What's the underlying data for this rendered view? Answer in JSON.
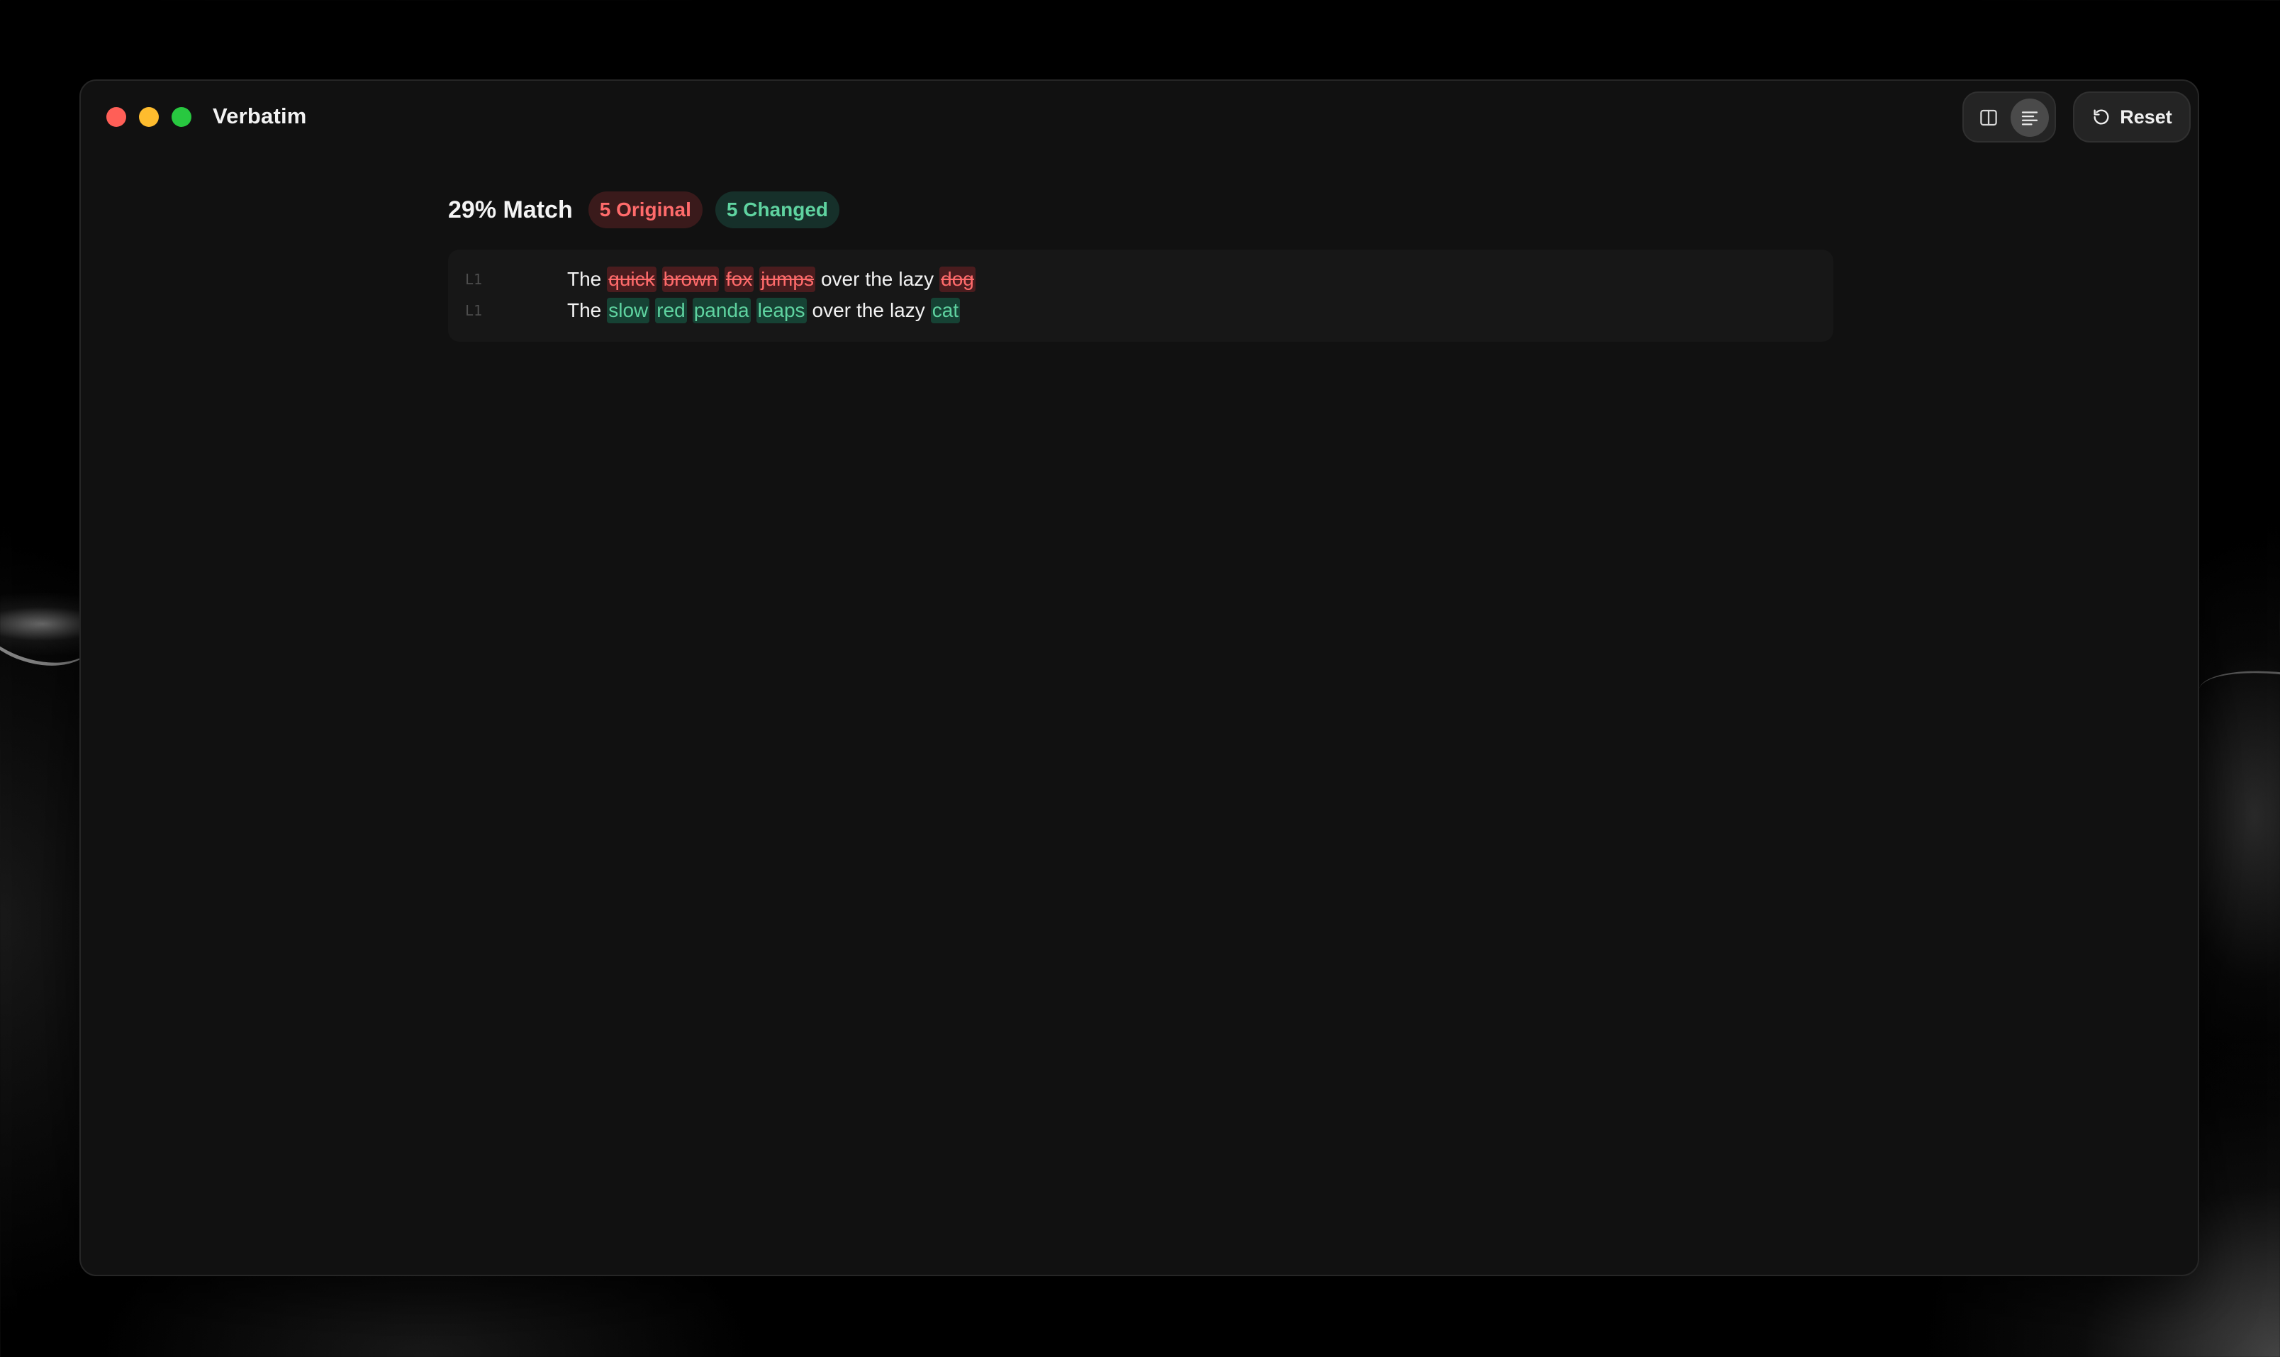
{
  "app": {
    "title": "Verbatim",
    "window_controls": [
      "close",
      "minimize",
      "zoom"
    ]
  },
  "toolbar": {
    "view_modes": [
      {
        "name": "split",
        "icon": "split-view-icon",
        "selected": false
      },
      {
        "name": "unified",
        "icon": "unified-view-icon",
        "selected": true
      }
    ],
    "reset_label": "Reset",
    "reset_icon": "reset-icon"
  },
  "summary": {
    "match": "29% Match",
    "original_badge": "5 Original",
    "changed_badge": "5 Changed"
  },
  "diff": {
    "lines": [
      {
        "line_label": "L1",
        "kind": "original",
        "tokens": [
          {
            "text": "The",
            "type": "same"
          },
          {
            "text": "quick",
            "type": "removed"
          },
          {
            "text": "brown",
            "type": "removed"
          },
          {
            "text": "fox",
            "type": "removed"
          },
          {
            "text": "jumps",
            "type": "removed"
          },
          {
            "text": "over",
            "type": "same"
          },
          {
            "text": "the",
            "type": "same"
          },
          {
            "text": "lazy",
            "type": "same"
          },
          {
            "text": "dog",
            "type": "removed"
          }
        ]
      },
      {
        "line_label": "L1",
        "kind": "changed",
        "tokens": [
          {
            "text": "The",
            "type": "same"
          },
          {
            "text": "slow",
            "type": "added"
          },
          {
            "text": "red",
            "type": "added"
          },
          {
            "text": "panda",
            "type": "added"
          },
          {
            "text": "leaps",
            "type": "added"
          },
          {
            "text": "over",
            "type": "same"
          },
          {
            "text": "the",
            "type": "same"
          },
          {
            "text": "lazy",
            "type": "same"
          },
          {
            "text": "cat",
            "type": "added"
          }
        ]
      }
    ]
  },
  "colors": {
    "removed": "#ff6b6b",
    "removed_bg": "#4a1c1e",
    "added": "#5fd3a0",
    "added_bg": "#164234",
    "window_bg": "#111111",
    "close": "#ff5f57",
    "minimize": "#febc2e",
    "zoom": "#28c840"
  }
}
